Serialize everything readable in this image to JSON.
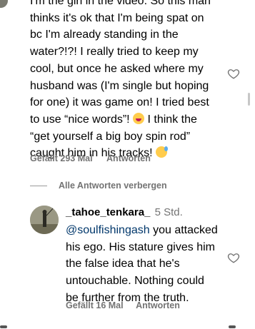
{
  "comment": {
    "lines": [
      "I'm the girl in the video. So this man",
      "thinks it's ok that I'm being spat on",
      "bc I'm already standing in the",
      "water?!?! I really tried to keep my",
      "cool, but once he asked where my",
      "husband was (I'm single but hoping",
      "for one) it was game on! I tried best",
      "to use “nice words”!",
      "I think the",
      "“get yourself a big boy spin rod”",
      "caught him in his tracks!"
    ],
    "likes_label": "Gefällt 293 Mal",
    "reply_label": "Antworten",
    "emoji_1": "squinting-laughing-emoji",
    "emoji_2": "sweat-smile-emoji"
  },
  "hide_replies_label": "Alle Antworten verbergen",
  "reply": {
    "username": "_tahoe_tenkara_",
    "time": "5 Std.",
    "mention": "@soulfishingash",
    "lines_after_mention": " you attacked",
    "lines": [
      "his ego. His stature gives him",
      "the false idea that he's",
      "untouchable. Nothing could",
      "be further from the truth."
    ],
    "likes_label": "Gefällt 16 Mal",
    "reply_label": "Antworten"
  },
  "colors": {
    "text": "#000000",
    "secondary": "#737373",
    "mention": "#00376b"
  },
  "icons": [
    "heart-outline-icon"
  ]
}
